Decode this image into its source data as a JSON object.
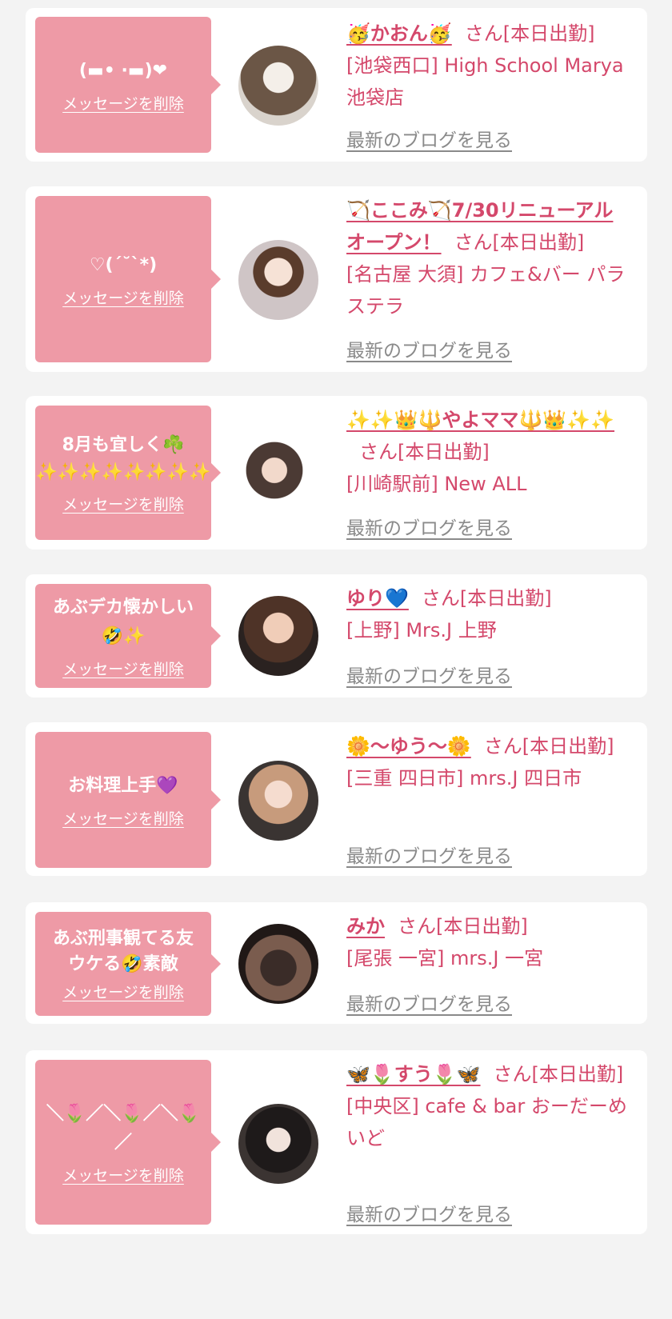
{
  "common": {
    "delete_label": "メッセージを削除",
    "blog_label": "最新のブログを見る"
  },
  "colors": {
    "bubble_bg": "#ee9aa6",
    "name_color": "#d4486b",
    "link_gray": "#8a8a8a",
    "page_bg": "#f3f3f3"
  },
  "cards": [
    {
      "message": "(▬• ·▬)❤",
      "name": "🥳かおん🥳",
      "suffix": "さん[本日出勤]",
      "shop": "[池袋西口] High School Marya 池袋店"
    },
    {
      "message": "♡(´˘`*)",
      "name": "🏹ここみ🏹7/30リニューアルオープン！",
      "suffix": "さん[本日出勤]",
      "shop": "[名古屋 大須] カフェ&バー パラステラ"
    },
    {
      "message": "8月も宜しく☘️ ✨✨✨✨✨✨✨✨",
      "name": "✨✨👑🔱やよママ🔱👑✨✨",
      "suffix": "さん[本日出勤]",
      "shop": "[川崎駅前] New ALL"
    },
    {
      "message": "あぶデカ懐かしい 🤣✨",
      "name": "ゆり💙",
      "suffix": "さん[本日出勤]",
      "shop": "[上野] Mrs.J 上野"
    },
    {
      "message": "お料理上手💜",
      "name": "🌼〜ゆう〜🌼",
      "suffix": "さん[本日出勤]",
      "shop": "[三重 四日市] mrs.J 四日市"
    },
    {
      "message": "あぶ刑事観てる友 ウケる🤣素敵",
      "name": "みか",
      "suffix": "さん[本日出勤]",
      "shop": "[尾張 一宮] mrs.J 一宮"
    },
    {
      "message": "＼🌷／＼🌷／＼🌷／",
      "name": "🦋🌷すう🌷🦋",
      "suffix": "さん[本日出勤]",
      "shop": "[中央区] cafe & bar おーだーめいど"
    }
  ]
}
